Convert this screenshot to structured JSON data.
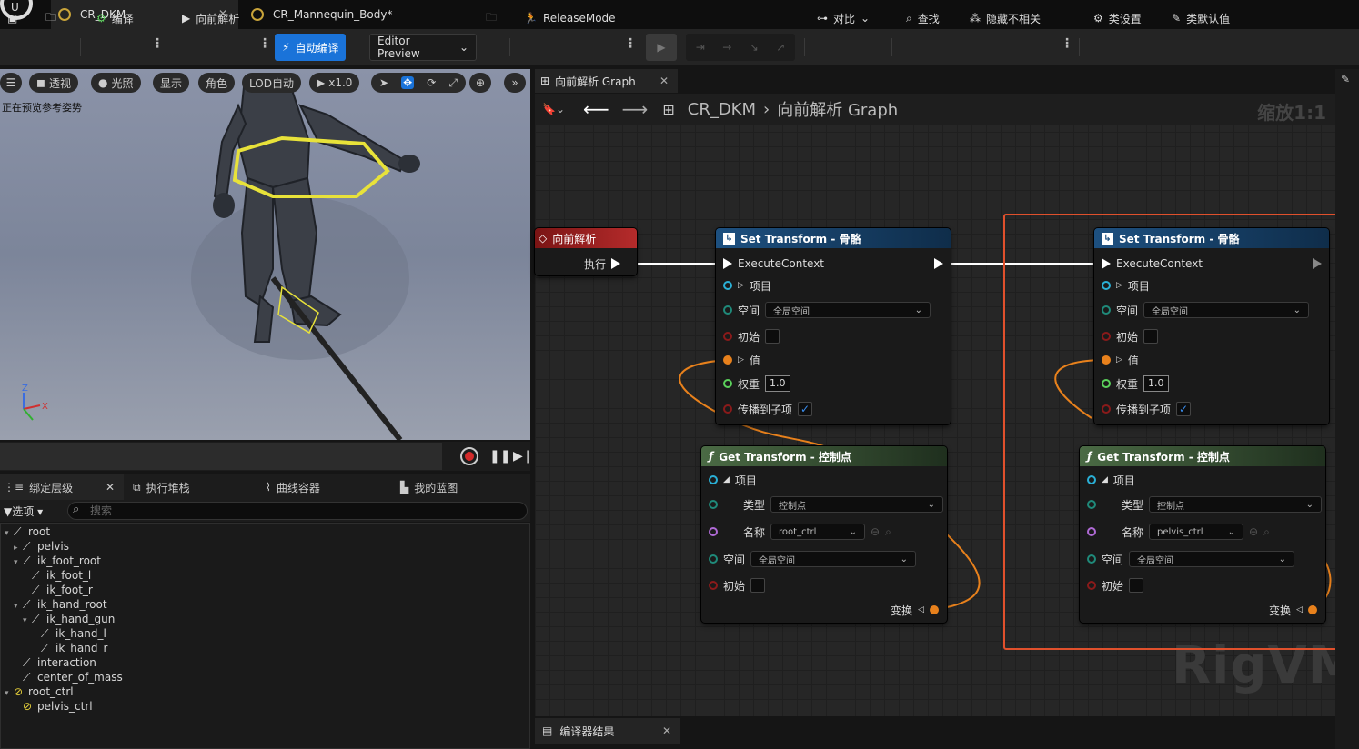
{
  "tabs": [
    {
      "label": "CR_DKM",
      "active": true
    },
    {
      "label": "CR_Mannequin_Body*",
      "active": false
    }
  ],
  "toolbar": {
    "compile": "编译",
    "forward_solve": "向前解析",
    "auto_compile": "自动编译",
    "preview_mode": "Editor Preview",
    "release_mode": "ReleaseMode",
    "diff": "对比",
    "find": "查找",
    "hide_unrelated": "隐藏不相关",
    "class_settings": "类设置",
    "class_defaults": "类默认值"
  },
  "viewport": {
    "perspective": "透视",
    "lit": "光照",
    "show": "显示",
    "character": "角色",
    "lod": "LOD自动",
    "speed": "x1.0",
    "preview_note": "正在预览参考姿势",
    "axis_x": "X",
    "axis_z": "Z"
  },
  "left_tabs": {
    "hierarchy": "绑定层级",
    "exec_stack": "执行堆栈",
    "curve": "曲线容器",
    "my_blueprint": "我的蓝图"
  },
  "options": "选项",
  "search_placeholder": "搜索",
  "tree": [
    {
      "label": "root",
      "depth": 0,
      "kind": "bone",
      "exp": "open"
    },
    {
      "label": "pelvis",
      "depth": 1,
      "kind": "bone",
      "exp": "closed"
    },
    {
      "label": "ik_foot_root",
      "depth": 1,
      "kind": "bone",
      "exp": "open"
    },
    {
      "label": "ik_foot_l",
      "depth": 2,
      "kind": "bone",
      "exp": ""
    },
    {
      "label": "ik_foot_r",
      "depth": 2,
      "kind": "bone",
      "exp": ""
    },
    {
      "label": "ik_hand_root",
      "depth": 1,
      "kind": "bone",
      "exp": "open"
    },
    {
      "label": "ik_hand_gun",
      "depth": 2,
      "kind": "bone",
      "exp": "open"
    },
    {
      "label": "ik_hand_l",
      "depth": 3,
      "kind": "bone",
      "exp": ""
    },
    {
      "label": "ik_hand_r",
      "depth": 3,
      "kind": "bone",
      "exp": ""
    },
    {
      "label": "interaction",
      "depth": 1,
      "kind": "bone",
      "exp": ""
    },
    {
      "label": "center_of_mass",
      "depth": 1,
      "kind": "bone",
      "exp": ""
    },
    {
      "label": "root_ctrl",
      "depth": 0,
      "kind": "ctrl",
      "exp": "open"
    },
    {
      "label": "pelvis_ctrl",
      "depth": 1,
      "kind": "ctrl",
      "exp": ""
    }
  ],
  "graph": {
    "tab": "向前解析 Graph",
    "breadcrumb_root": "CR_DKM",
    "breadcrumb_graph": "向前解析 Graph",
    "zoom": "缩放1:1",
    "watermark": "RigVM",
    "event": {
      "title": "向前解析",
      "exec": "执行"
    },
    "set1": {
      "title": "Set Transform - 骨骼",
      "exec": "ExecuteContext",
      "item": "项目",
      "space": "空间",
      "space_val": "全局空间",
      "initial": "初始",
      "value": "值",
      "weight": "权重",
      "weight_val": "1.0",
      "propagate": "传播到子项"
    },
    "set2": {
      "title": "Set Transform - 骨骼",
      "exec": "ExecuteContext",
      "item": "项目",
      "space": "空间",
      "space_val": "全局空间",
      "initial": "初始",
      "value": "值",
      "weight": "权重",
      "weight_val": "1.0",
      "propagate": "传播到子项"
    },
    "get1": {
      "title": "Get Transform - 控制点",
      "item": "项目",
      "type": "类型",
      "type_val": "控制点",
      "name": "名称",
      "name_val": "root_ctrl",
      "space": "空间",
      "space_val": "全局空间",
      "initial": "初始",
      "transform": "变换"
    },
    "get2": {
      "title": "Get Transform - 控制点",
      "item": "项目",
      "type": "类型",
      "type_val": "控制点",
      "name": "名称",
      "name_val": "pelvis_ctrl",
      "space": "空间",
      "space_val": "全局空间",
      "initial": "初始",
      "transform": "变换"
    }
  },
  "compiler_results": "编译器结果",
  "colors": {
    "accent": "#1a73d9",
    "selection": "#e0502c",
    "set_header": "#1d4f7a",
    "get_header": "#3d5a3a",
    "event_header": "#8a1c1c"
  }
}
